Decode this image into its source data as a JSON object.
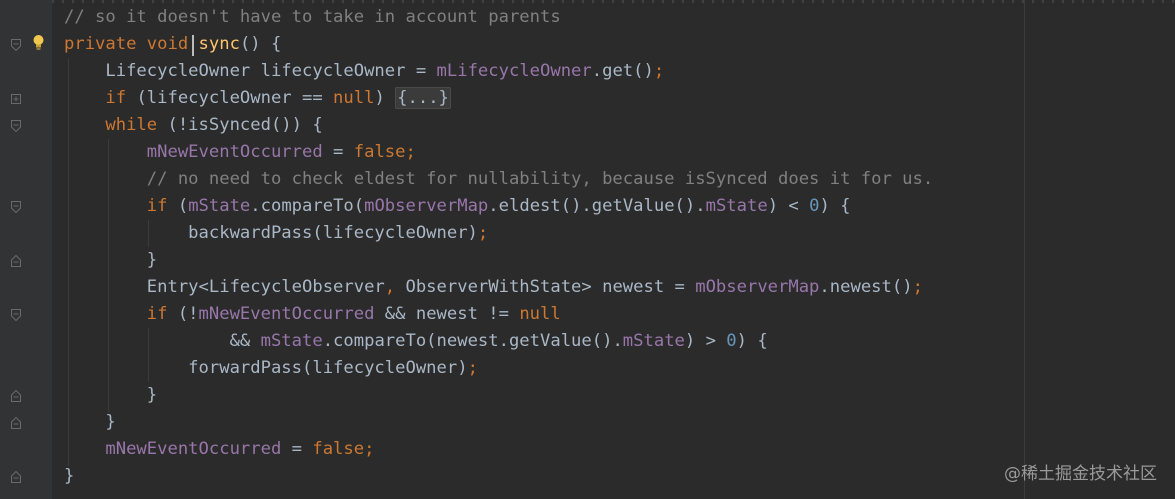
{
  "editor": {
    "lines": [
      {
        "parts": [
          [
            "cm",
            "// so it doesn't have to take in account parents"
          ]
        ]
      },
      {
        "parts": [
          [
            "kw",
            "private void "
          ],
          [
            "fn",
            "sync"
          ],
          [
            "",
            "() {"
          ]
        ]
      },
      {
        "parts": [
          [
            "",
            "    LifecycleOwner lifecycleOwner = "
          ],
          [
            "fld",
            "mLifecycleOwner"
          ],
          [
            "",
            ".get()"
          ],
          [
            "kw",
            ";"
          ]
        ]
      },
      {
        "parts": [
          [
            "kw",
            "    if "
          ],
          [
            "",
            "(lifecycleOwner == "
          ],
          [
            "kw",
            "null"
          ],
          [
            "",
            ") "
          ],
          [
            "fold",
            "{...}"
          ]
        ]
      },
      {
        "parts": [
          [
            "kw",
            "    while "
          ],
          [
            "",
            "(!isSynced()) {"
          ]
        ]
      },
      {
        "parts": [
          [
            "fld",
            "        mNewEventOccurred"
          ],
          [
            "",
            " = "
          ],
          [
            "kw",
            "false;"
          ]
        ]
      },
      {
        "parts": [
          [
            "cm",
            "        // no need to check eldest for nullability, because isSynced does it for us."
          ]
        ]
      },
      {
        "parts": [
          [
            "kw",
            "        if "
          ],
          [
            "",
            "("
          ],
          [
            "fld",
            "mState"
          ],
          [
            "",
            ".compareTo("
          ],
          [
            "fld",
            "mObserverMap"
          ],
          [
            "",
            ".eldest().getValue()."
          ],
          [
            "fld",
            "mState"
          ],
          [
            "",
            ") < "
          ],
          [
            "num",
            "0"
          ],
          [
            "",
            ") {"
          ]
        ]
      },
      {
        "parts": [
          [
            "",
            "            backwardPass(lifecycleOwner)"
          ],
          [
            "kw",
            ";"
          ]
        ]
      },
      {
        "parts": [
          [
            "",
            "        }"
          ]
        ]
      },
      {
        "parts": [
          [
            "",
            "        Entry<LifecycleObserver"
          ],
          [
            "kw",
            ", "
          ],
          [
            "",
            "ObserverWithState> newest = "
          ],
          [
            "fld",
            "mObserverMap"
          ],
          [
            "",
            ".newest()"
          ],
          [
            "kw",
            ";"
          ]
        ]
      },
      {
        "parts": [
          [
            "kw",
            "        if "
          ],
          [
            "",
            "(!"
          ],
          [
            "fld",
            "mNewEventOccurred"
          ],
          [
            "",
            " && newest != "
          ],
          [
            "kw",
            "null"
          ]
        ]
      },
      {
        "parts": [
          [
            "",
            "                && "
          ],
          [
            "fld",
            "mState"
          ],
          [
            "",
            ".compareTo(newest.getValue()."
          ],
          [
            "fld",
            "mState"
          ],
          [
            "",
            ") > "
          ],
          [
            "num",
            "0"
          ],
          [
            "",
            ") {"
          ]
        ]
      },
      {
        "parts": [
          [
            "",
            "            forwardPass(lifecycleOwner)"
          ],
          [
            "kw",
            ";"
          ]
        ]
      },
      {
        "parts": [
          [
            "",
            "        }"
          ]
        ]
      },
      {
        "parts": [
          [
            "",
            "    }"
          ]
        ]
      },
      {
        "parts": [
          [
            "fld",
            "    mNewEventOccurred"
          ],
          [
            "",
            " = "
          ],
          [
            "kw",
            "false;"
          ]
        ]
      },
      {
        "parts": [
          [
            "",
            "}"
          ]
        ]
      }
    ]
  },
  "gutter": {
    "fold_icons": [
      {
        "line": 1,
        "kind": "open"
      },
      {
        "line": 3,
        "kind": "collapsed"
      },
      {
        "line": 4,
        "kind": "open"
      },
      {
        "line": 7,
        "kind": "open"
      },
      {
        "line": 9,
        "kind": "close"
      },
      {
        "line": 11,
        "kind": "open"
      },
      {
        "line": 14,
        "kind": "close"
      },
      {
        "line": 15,
        "kind": "close"
      },
      {
        "line": 17,
        "kind": "close"
      }
    ],
    "bulb_icon": "lightbulb-icon"
  },
  "watermark": {
    "text": "@稀土掘金技术社区"
  },
  "colors": {
    "background": "#2b2b2b",
    "gutter": "#313335",
    "keyword": "#cc7832",
    "field": "#9876aa",
    "number": "#6897bb",
    "comment": "#808080",
    "function": "#ffc66d",
    "text": "#a9b7c6"
  }
}
